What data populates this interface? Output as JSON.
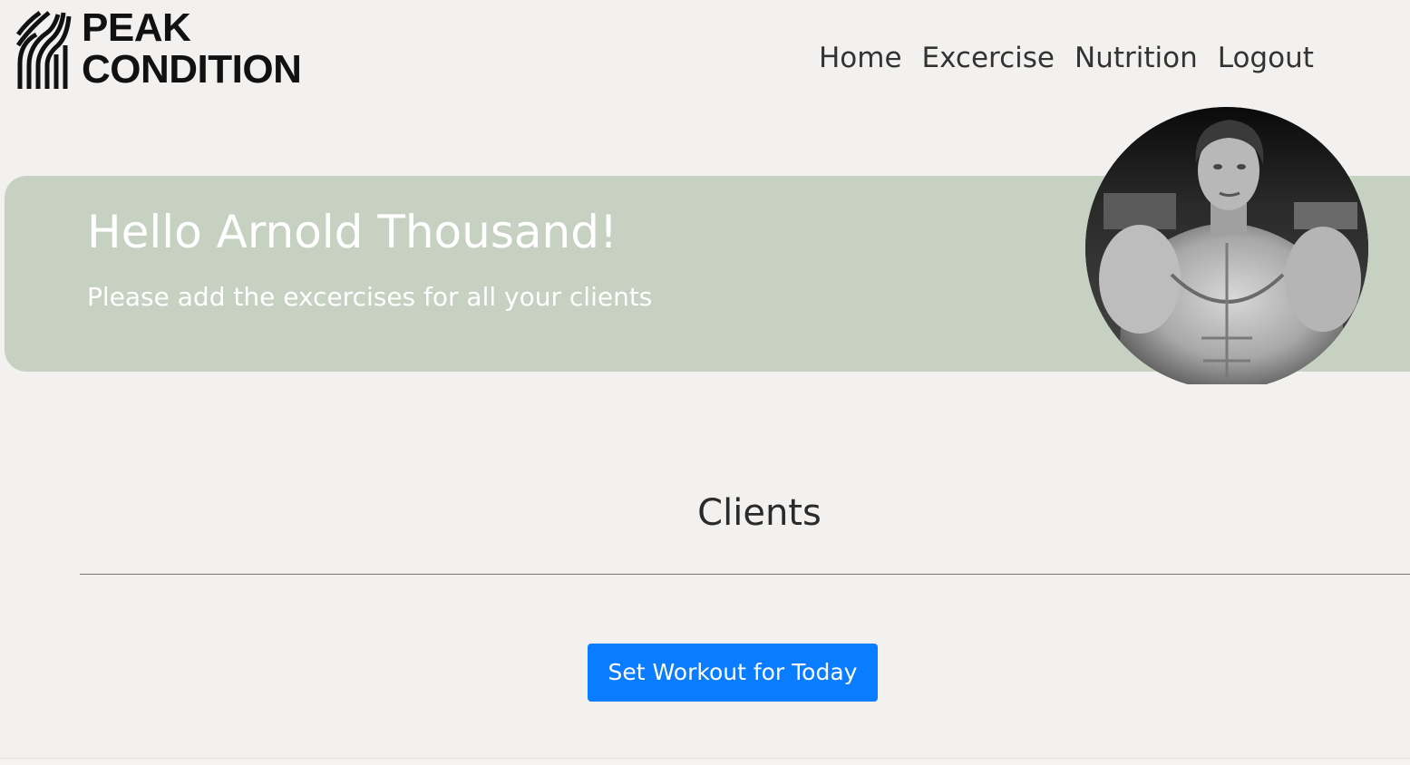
{
  "brand": {
    "line1": "PEAK",
    "line2": "CONDITION"
  },
  "nav": {
    "items": [
      {
        "label": "Home"
      },
      {
        "label": "Excercise"
      },
      {
        "label": "Nutrition"
      },
      {
        "label": "Logout"
      }
    ]
  },
  "hero": {
    "greeting": "Hello Arnold Thousand!",
    "subtitle": "Please add the excercises for all your clients"
  },
  "clients": {
    "title": "Clients",
    "button_label": "Set Workout for Today"
  },
  "colors": {
    "background": "#f2f1ef",
    "hero_band": "#c6d1c2",
    "primary_button": "#0a7cff"
  },
  "icons": {
    "logo_mark": "peak-stripes-icon"
  }
}
